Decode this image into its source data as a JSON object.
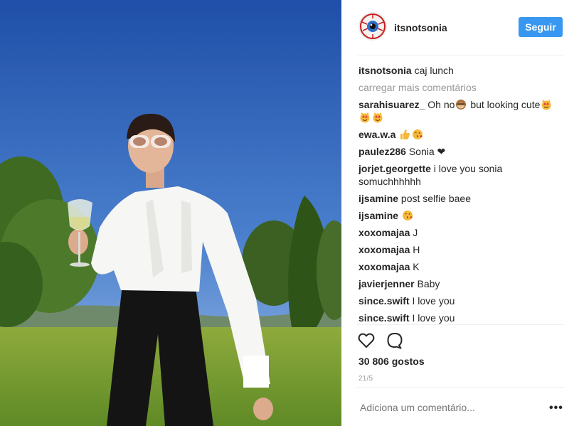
{
  "post": {
    "username": "itsnotsonia",
    "follow_label": "Seguir",
    "likes": "30 806 gostos",
    "date": "21/5",
    "add_comment_placeholder": "Adiciona um comentário...",
    "more_options": "•••",
    "load_more": "carregar mais comentários",
    "caption": {
      "user": "itsnotsonia",
      "text": "caj lunch"
    }
  },
  "comments": [
    {
      "user": "sarahisuarez_",
      "text": "Oh no",
      "text2": "but looking cute",
      "icons": [
        "see-no-evil-monkey-emoji",
        "heart-eyes-cat-emoji"
      ]
    },
    {
      "user": "ewa.w.a",
      "text": "",
      "icons": [
        "thumbs-up-emoji",
        "face-blowing-kiss-emoji"
      ]
    },
    {
      "user": "paulez286",
      "text": "Sonia ❤"
    },
    {
      "user": "jorjet.georgette",
      "text": "i love you sonia somuchhhhhh"
    },
    {
      "user": "ijsamine",
      "text": "post selfie baee"
    },
    {
      "user": "ijsamine",
      "text": "",
      "icons": [
        "face-blowing-kiss-emoji"
      ]
    },
    {
      "user": "xoxomajaa",
      "text": "J"
    },
    {
      "user": "xoxomajaa",
      "text": "H"
    },
    {
      "user": "xoxomajaa",
      "text": "K"
    },
    {
      "user": "javierjenner",
      "text": "Baby"
    },
    {
      "user": "since.swift",
      "text": "I love you"
    },
    {
      "user": "since.swift",
      "text": "I love you"
    }
  ],
  "icons": {
    "avatar": "eyeball-avatar-icon",
    "like": "heart-outline-icon",
    "comment": "speech-bubble-outline-icon"
  },
  "colors": {
    "follow_button": "#3897f0",
    "muted_text": "#999999",
    "text": "#262626"
  }
}
